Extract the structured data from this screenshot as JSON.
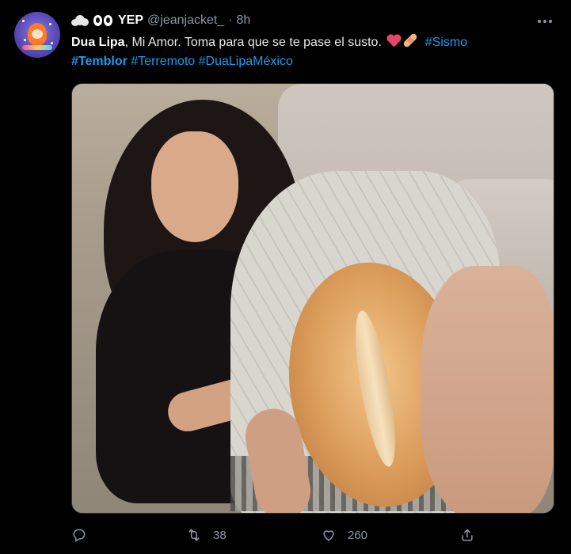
{
  "tweet": {
    "display_name": "YEP",
    "handle": "@jeanjacket_",
    "separator": "·",
    "timestamp": "8h",
    "text": {
      "bold_name": "Dua Lipa",
      "body": ", Mi Amor. Toma para que se te pase el susto.",
      "hashtag_1": "#Sismo",
      "hashtag_2": "#Temblor",
      "hashtag_3": "#Terremoto",
      "hashtag_4": "#DuaLipaMéxico"
    },
    "icons": {
      "name_prefix": [
        "cloud-icon",
        "eyes-icon"
      ],
      "text_emoji": [
        "heart-icon",
        "bandage-icon"
      ],
      "more": "more-dots-icon"
    },
    "stats": {
      "replies": "",
      "retweets": "38",
      "likes": "260"
    }
  },
  "colors": {
    "background": "#000000",
    "primary_text": "#e7e9ea",
    "secondary_text": "#8b98a5",
    "accent": "#1d9bf0"
  }
}
